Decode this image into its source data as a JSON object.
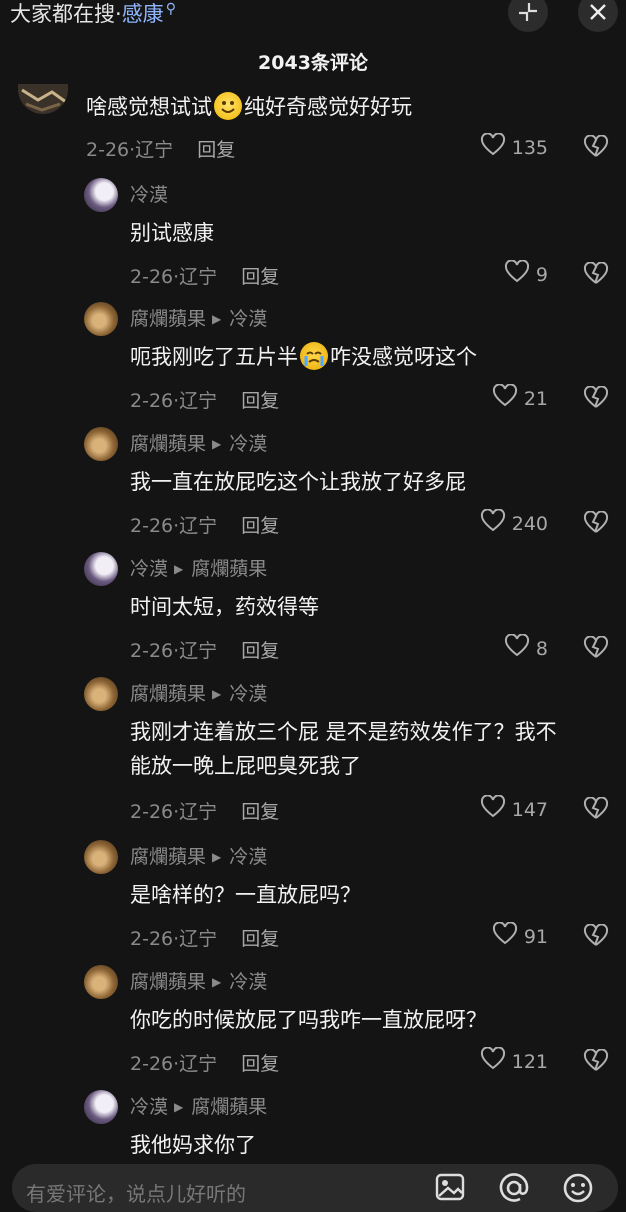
{
  "header": {
    "search_prefix": "大家都在搜·",
    "search_keyword": "感康",
    "search_icon": "search-icon",
    "collapse_icon": "collapse-icon",
    "close_icon": "close-icon",
    "comment_count": "2043条评论"
  },
  "comments": [
    {
      "text_a": "啥感觉想试试",
      "emoji_a": "smile-emoji",
      "text_b": "纯好奇感觉好好玩",
      "date": "2-26",
      "location": "辽宁",
      "reply": "回复",
      "likes": "135"
    },
    {
      "user": "冷漠",
      "text": "别试感康",
      "date": "2-26",
      "location": "辽宁",
      "reply": "回复",
      "likes": "9"
    },
    {
      "user": "腐爛蘋果",
      "reply_to": "冷漠",
      "text_a": "呃我刚吃了五片半",
      "emoji_a": "crying-emoji",
      "text_b": "咋没感觉呀这个",
      "date": "2-26",
      "location": "辽宁",
      "reply": "回复",
      "likes": "21"
    },
    {
      "user": "腐爛蘋果",
      "reply_to": "冷漠",
      "text": "我一直在放屁吃这个让我放了好多屁",
      "date": "2-26",
      "location": "辽宁",
      "reply": "回复",
      "likes": "240"
    },
    {
      "user": "冷漠",
      "reply_to": "腐爛蘋果",
      "text": "时间太短，药效得等",
      "date": "2-26",
      "location": "辽宁",
      "reply": "回复",
      "likes": "8"
    },
    {
      "user": "腐爛蘋果",
      "reply_to": "冷漠",
      "text_l1": "我刚才连着放三个屁 是不是药效发作了？我不",
      "text_l2": "能放一晚上屁吧臭死我了",
      "date": "2-26",
      "location": "辽宁",
      "reply": "回复",
      "likes": "147"
    },
    {
      "user": "腐爛蘋果",
      "reply_to": "冷漠",
      "text": "是啥样的？一直放屁吗？",
      "date": "2-26",
      "location": "辽宁",
      "reply": "回复",
      "likes": "91"
    },
    {
      "user": "腐爛蘋果",
      "reply_to": "冷漠",
      "text": "你吃的时候放屁了吗我咋一直放屁呀？",
      "date": "2-26",
      "location": "辽宁",
      "reply": "回复",
      "likes": "121"
    },
    {
      "user": "冷漠",
      "reply_to": "腐爛蘋果",
      "text": "我他妈求你了"
    }
  ],
  "input": {
    "placeholder": "有爱评论，说点儿好听的",
    "image_icon": "image-icon",
    "mention_icon": "at-mention-icon",
    "emoji_icon": "emoji-icon"
  },
  "colors": {
    "background": "#141414",
    "primary_text": "#f2f2f2",
    "secondary_text": "#8a8a8a",
    "accent": "#8fb6ff"
  }
}
